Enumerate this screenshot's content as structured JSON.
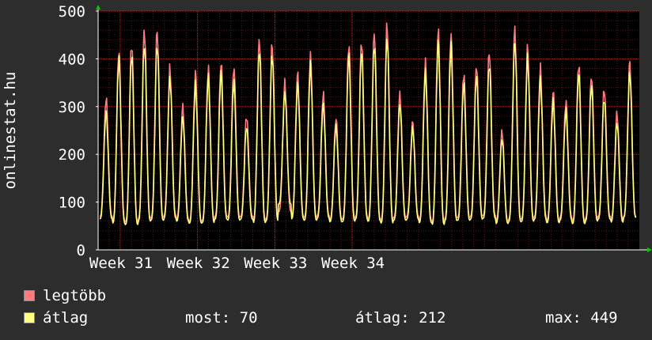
{
  "chart_data": {
    "type": "line",
    "title": "",
    "xlabel": "",
    "ylabel": "onlinestat.hu",
    "ylim": [
      0,
      500
    ],
    "y_ticks": [
      0,
      100,
      200,
      300,
      400,
      500
    ],
    "x_ticks": [
      "Week 31",
      "Week 32",
      "Week 33",
      "Week 34"
    ],
    "grid": true,
    "legend_position": "bottom-left",
    "days": 49,
    "series": [
      {
        "name": "legtöbb",
        "color": "#ff7b82",
        "daily_peaks": [
          318,
          418,
          432,
          460,
          458,
          380,
          300,
          370,
          378,
          392,
          383,
          280,
          442,
          430,
          350,
          368,
          405,
          326,
          275,
          430,
          438,
          456,
          470,
          325,
          267,
          390,
          458,
          452,
          370,
          387,
          415,
          248,
          460,
          422,
          380,
          331,
          311,
          390,
          365,
          337,
          286,
          392
        ],
        "daily_troughs": [
          70,
          62,
          58,
          65,
          68,
          72,
          65,
          60,
          62,
          70,
          68,
          70,
          62,
          66,
          80,
          70,
          68,
          72,
          64,
          66,
          70,
          65,
          62,
          68,
          70,
          62,
          58,
          66,
          68,
          70,
          72,
          60,
          64,
          66,
          70,
          62,
          68,
          60,
          66,
          70,
          64,
          70
        ]
      },
      {
        "name": "átlag",
        "color": "#ffff80",
        "daily_peaks": [
          290,
          400,
          410,
          432,
          430,
          360,
          280,
          345,
          362,
          370,
          352,
          258,
          420,
          410,
          330,
          348,
          385,
          305,
          258,
          408,
          415,
          432,
          445,
          305,
          255,
          370,
          435,
          425,
          350,
          365,
          390,
          232,
          438,
          402,
          358,
          312,
          292,
          370,
          345,
          318,
          268,
          372
        ],
        "daily_troughs": [
          65,
          56,
          53,
          60,
          62,
          66,
          60,
          56,
          57,
          64,
          62,
          64,
          57,
          61,
          96,
          65,
          62,
          66,
          59,
          60,
          64,
          60,
          56,
          62,
          64,
          57,
          53,
          61,
          62,
          64,
          66,
          55,
          59,
          60,
          64,
          57,
          62,
          55,
          60,
          64,
          58,
          68
        ]
      }
    ]
  },
  "legend": {
    "max_label": "legtöbb",
    "avg_label": "átlag",
    "max_color": "#ff7b82",
    "avg_color": "#ffff80"
  },
  "stats": {
    "now": "most: 70",
    "avg": "átlag: 212",
    "max": "max: 449"
  }
}
